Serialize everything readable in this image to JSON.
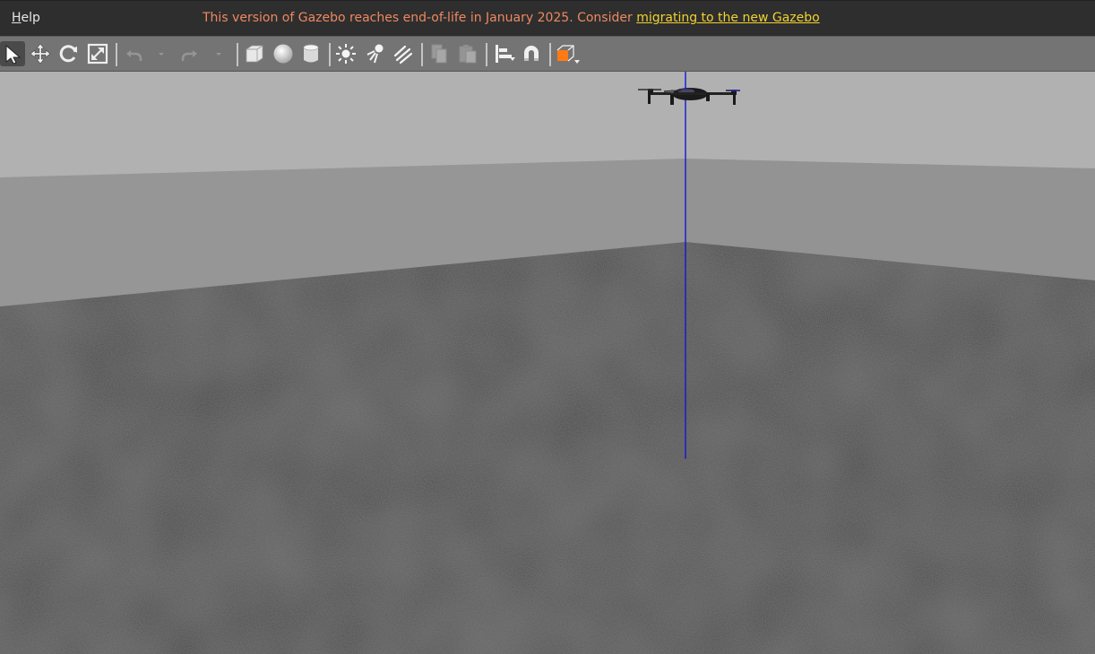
{
  "menubar": {
    "help_mnemonic": "H",
    "help_rest": "elp",
    "banner_text": "This version of Gazebo reaches end-of-life in January 2025. Consider ",
    "banner_link": "migrating to the new Gazebo"
  },
  "toolbar": {
    "tools": [
      {
        "name": "select-mode",
        "icon": "arrow-pointer-icon",
        "active": true
      },
      {
        "name": "translate-mode",
        "icon": "move-arrows-icon"
      },
      {
        "name": "rotate-mode",
        "icon": "rotate-icon"
      },
      {
        "name": "scale-mode",
        "icon": "scale-icon"
      },
      {
        "name": "undo",
        "icon": "undo-icon",
        "enabled": false
      },
      {
        "name": "redo",
        "icon": "redo-icon",
        "enabled": false
      },
      {
        "name": "box",
        "icon": "box-icon"
      },
      {
        "name": "sphere",
        "icon": "sphere-icon"
      },
      {
        "name": "cylinder",
        "icon": "cylinder-icon"
      },
      {
        "name": "point-light",
        "icon": "sun-icon"
      },
      {
        "name": "spot-light",
        "icon": "spotlight-icon"
      },
      {
        "name": "directional-light",
        "icon": "directional-light-icon"
      },
      {
        "name": "copy",
        "icon": "copy-icon",
        "enabled": false
      },
      {
        "name": "paste",
        "icon": "paste-icon",
        "enabled": false
      },
      {
        "name": "align",
        "icon": "align-icon"
      },
      {
        "name": "snap",
        "icon": "magnet-icon"
      },
      {
        "name": "view-angle",
        "icon": "orange-cube-icon"
      }
    ]
  },
  "scene": {
    "sky_color": "#b1b1b1",
    "wall_color": "#969696",
    "ground_color": "#414141",
    "axis_color": "#1515d8",
    "model": "quadcopter"
  }
}
